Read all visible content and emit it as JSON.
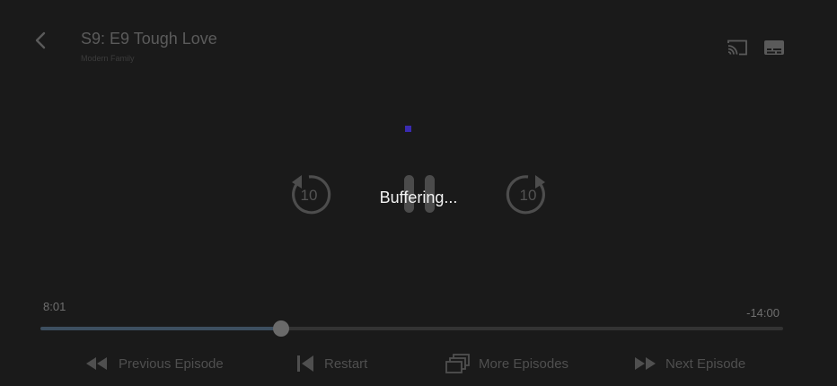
{
  "header": {
    "title": "S9: E9 Tough Love",
    "subtitle": "Modern Family",
    "back_icon": "chevron-left-icon",
    "cast_icon": "cast-icon",
    "subtitles_icon": "subtitles-icon"
  },
  "playback": {
    "status": "Buffering...",
    "state": "paused",
    "rewind_seconds": "10",
    "forward_seconds": "10"
  },
  "progress": {
    "elapsed": "8:01",
    "remaining": "-14:00",
    "fraction": 0.3242
  },
  "controls": {
    "previous_episode": "Previous Episode",
    "restart": "Restart",
    "more_episodes": "More Episodes",
    "next_episode": "Next Episode"
  },
  "colors": {
    "background": "#1a1a1a",
    "progress_played": "#3d4f60",
    "spinner_accent": "#3a2bb0"
  }
}
